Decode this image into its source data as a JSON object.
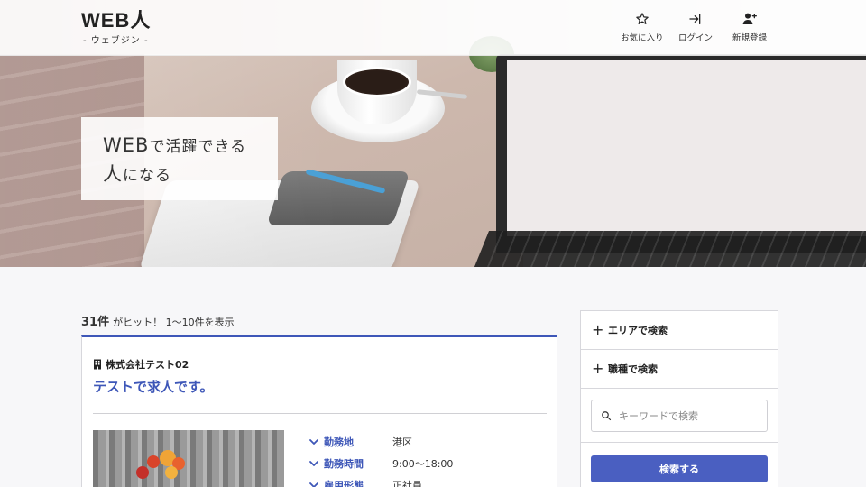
{
  "header": {
    "logo_main": "WEB人",
    "logo_sub": "- ウェブジン -",
    "nav": [
      {
        "label": "お気に入り",
        "icon": "star-icon"
      },
      {
        "label": "ログイン",
        "icon": "login-icon"
      },
      {
        "label": "新規登録",
        "icon": "user-plus-icon"
      }
    ]
  },
  "hero": {
    "line1_big": "WEB",
    "line1_rest": "で活躍できる",
    "line2_big": "人",
    "line2_rest": "になる"
  },
  "results": {
    "count": "31件",
    "summary": "がヒット！ 1〜10件を表示"
  },
  "job": {
    "company": "株式会社テスト02",
    "title": "テストで求人です。",
    "details": [
      {
        "label": "勤務地",
        "value": "港区"
      },
      {
        "label": "勤務時間",
        "value": "9:00〜18:00"
      },
      {
        "label": "雇用形態",
        "value": "正社員"
      }
    ]
  },
  "sidebar": {
    "area_label": "エリアで検索",
    "occupation_label": "職種で検索",
    "keyword_placeholder": "キーワードで検索",
    "search_button": "検索する"
  },
  "colors": {
    "accent": "#3e57b8",
    "button": "#4a5fc1"
  }
}
